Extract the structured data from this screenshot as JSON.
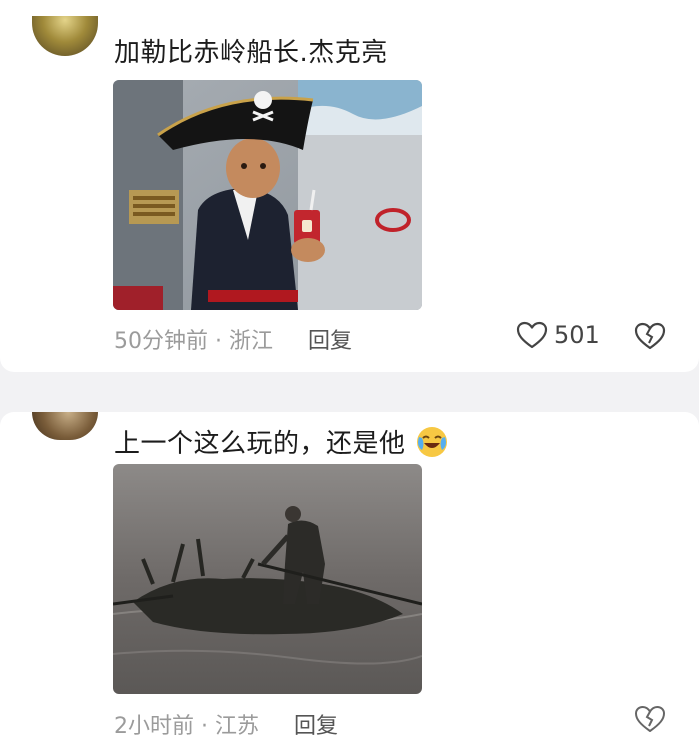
{
  "comments": [
    {
      "text": "加勒比赤岭船长.杰克亮",
      "image_description": "boy-in-pirate-costume-on-boat",
      "time": "50分钟前",
      "location": "浙江",
      "reply_label": "回复",
      "likes": "501",
      "avatar_icon": "avatar-image",
      "like_icon": "heart-outline-icon",
      "dislike_icon": "broken-heart-icon"
    },
    {
      "text": "上一个这么玩的，还是他",
      "emoji_icon": "crying-laughing-emoji",
      "image_description": "man-poling-raft-on-river",
      "time": "2小时前",
      "location": "江苏",
      "reply_label": "回复",
      "avatar_icon": "avatar-image",
      "dislike_icon": "broken-heart-icon"
    }
  ],
  "meta_separator": "·",
  "colors": {
    "background": "#f2f2f4",
    "card": "#ffffff",
    "text": "#1c1c1c",
    "meta": "#9b9b9b"
  }
}
